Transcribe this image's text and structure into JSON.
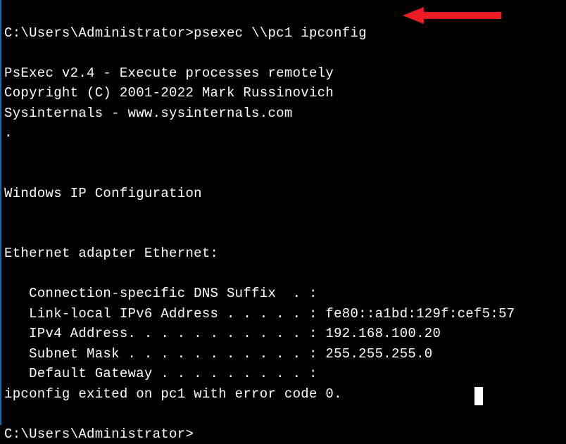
{
  "prompt1": "C:\\Users\\Administrator>",
  "command": "psexec \\\\pc1 ipconfig",
  "blank": "",
  "psexec_version": "PsExec v2.4 - Execute processes remotely",
  "copyright": "Copyright (C) 2001-2022 Mark Russinovich",
  "sysinternals": "Sysinternals - www.sysinternals.com",
  "dot_line": ".",
  "ip_config_header": "Windows IP Configuration",
  "adapter_header": "Ethernet adapter Ethernet:",
  "dns_suffix": "   Connection-specific DNS Suffix  . :",
  "ipv6": "   Link-local IPv6 Address . . . . . : fe80::a1bd:129f:cef5:57",
  "ipv4": "   IPv4 Address. . . . . . . . . . . : 192.168.100.20",
  "subnet": "   Subnet Mask . . . . . . . . . . . : 255.255.255.0",
  "gateway": "   Default Gateway . . . . . . . . . :",
  "exit_msg": "ipconfig exited on pc1 with error code 0.",
  "prompt2": "C:\\Users\\Administrator>",
  "arrow_color": "#ed1c24"
}
